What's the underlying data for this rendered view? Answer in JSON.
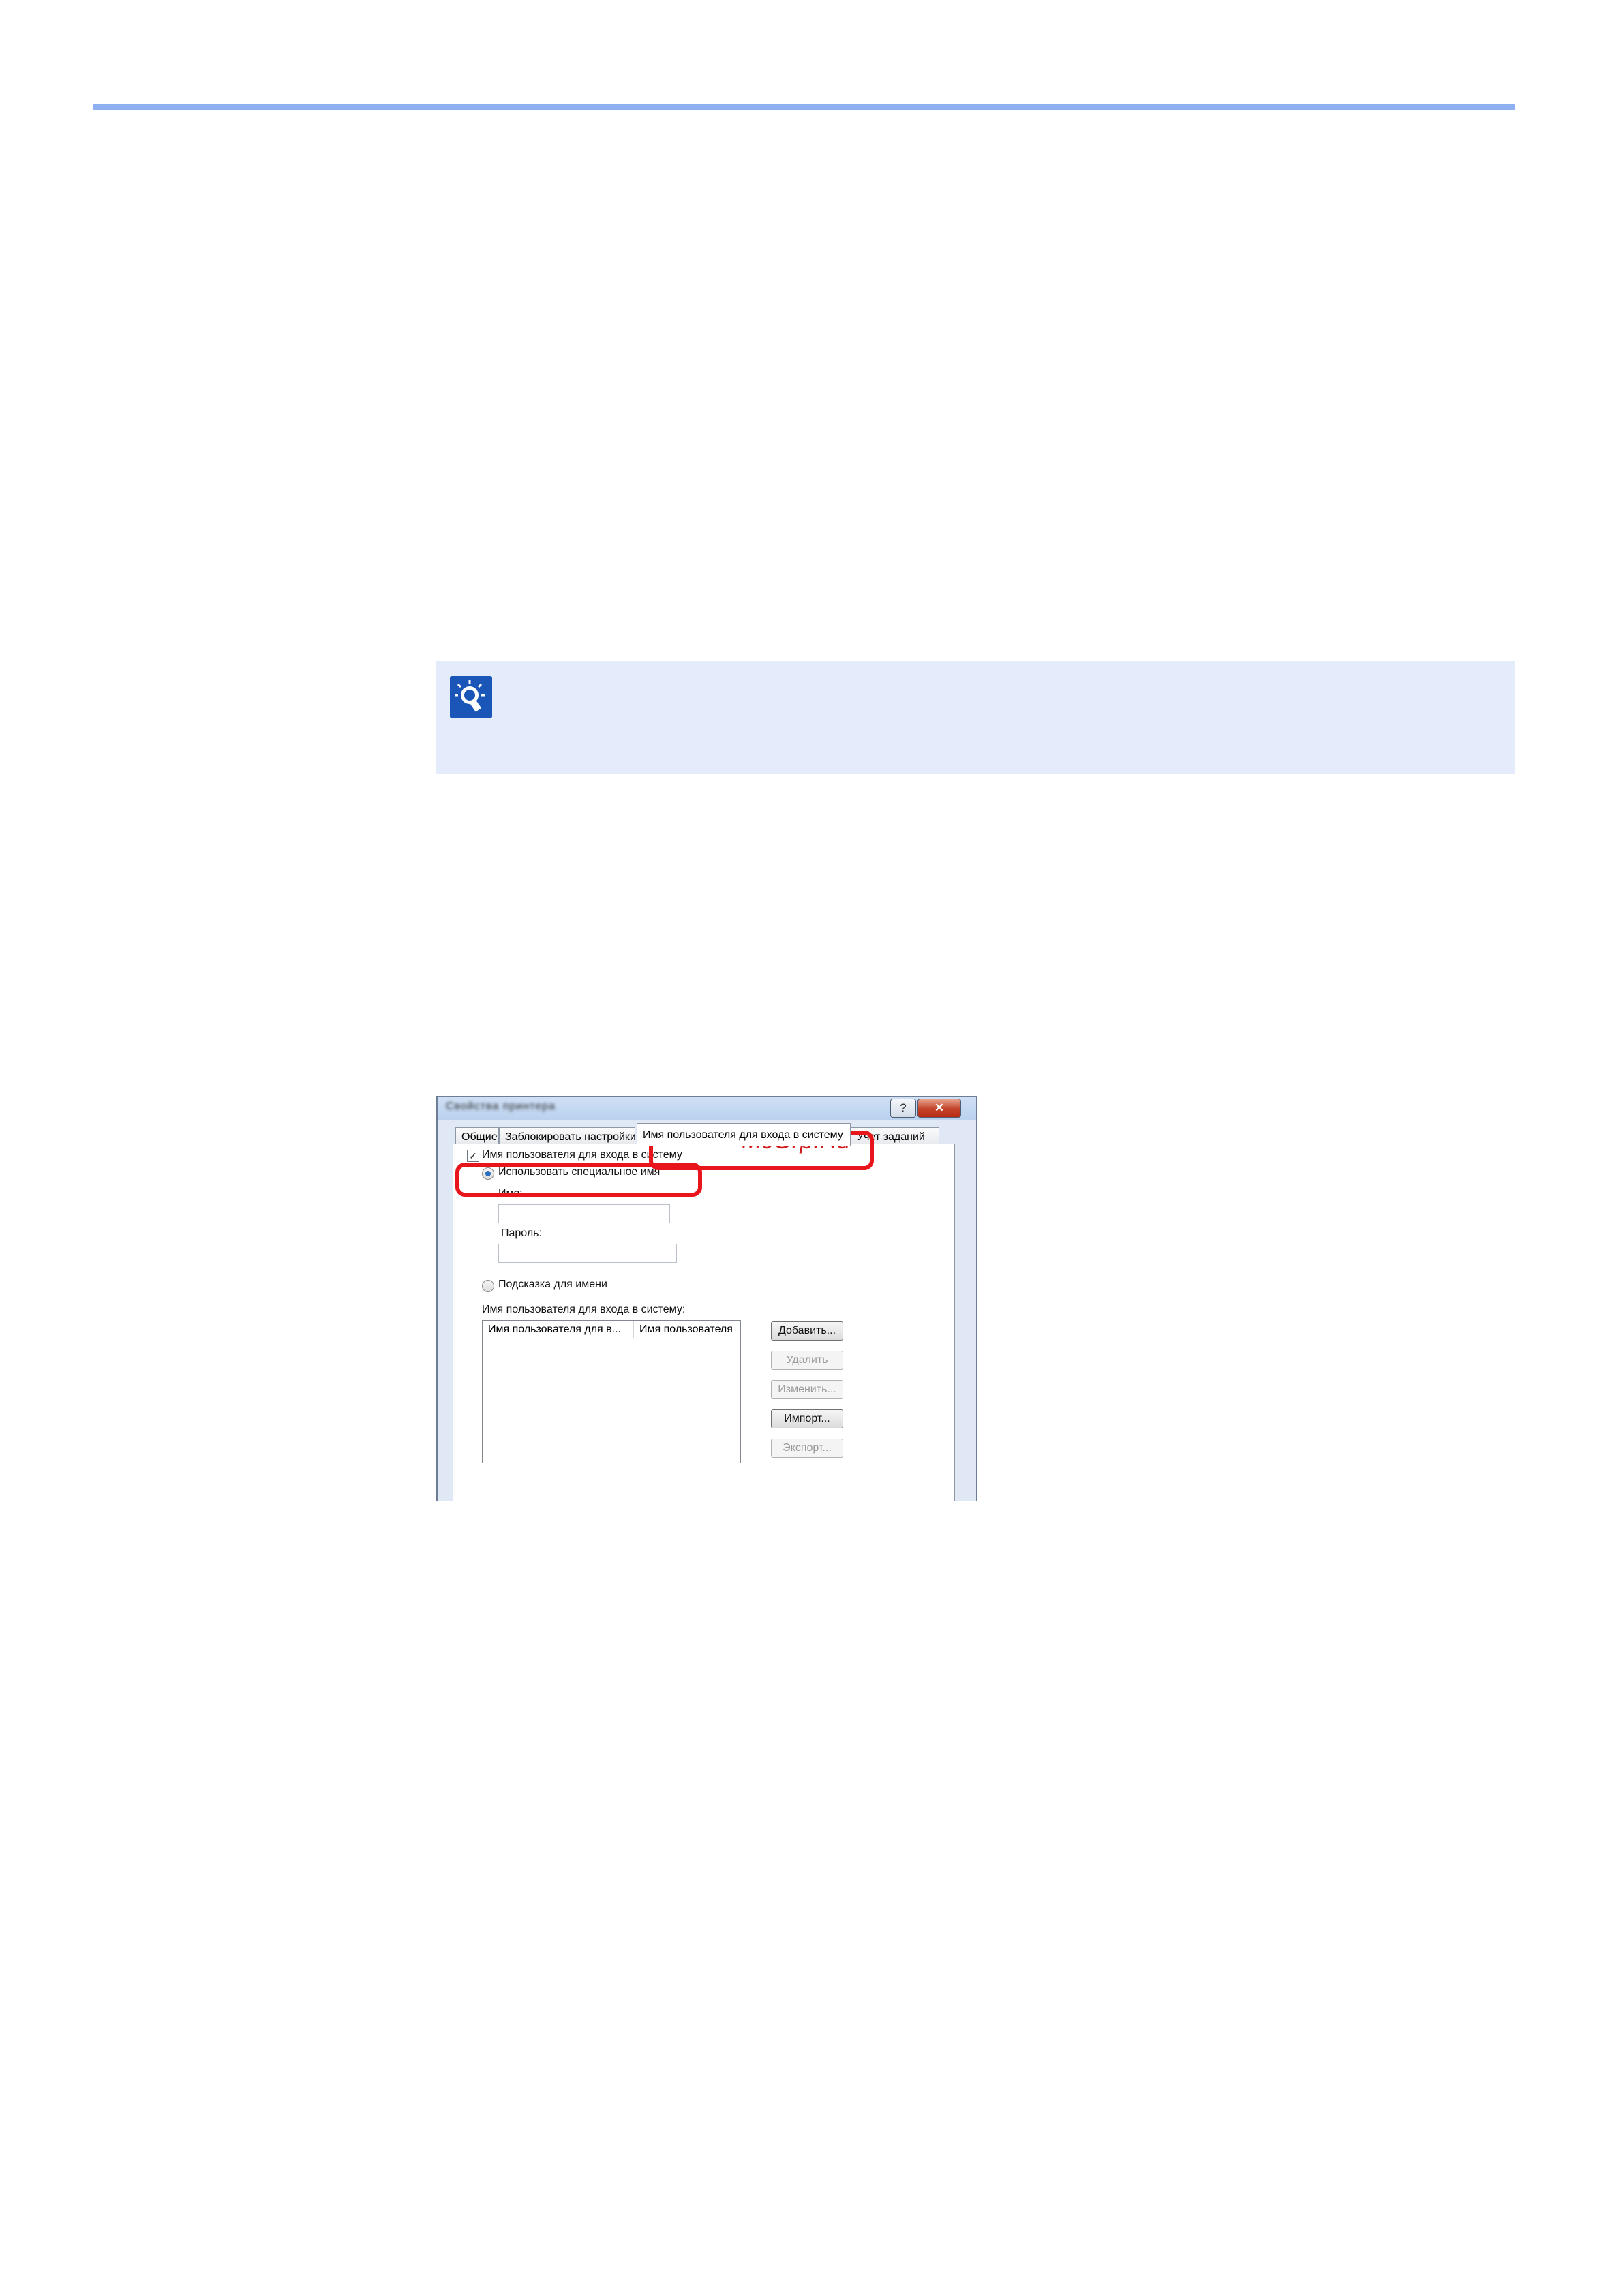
{
  "colors": {
    "accent_rule": "#8fb0f0",
    "note_bg": "#e4ebfb",
    "highlight": "#e8151b",
    "close_button": "#c3432a"
  },
  "note": {
    "icon": "lightbulb-icon"
  },
  "dialog": {
    "title": "Свойства принтера",
    "help_label": "?",
    "close_label": "✕",
    "tabs": [
      "Общие",
      "Заблокировать настройки",
      "Имя пользователя для входа в систему",
      "Учет заданий"
    ],
    "active_tab": 2,
    "login_checkbox": {
      "label": "Имя пользователя для входа в систему",
      "checked": true
    },
    "use_specific_name": {
      "label": "Использовать специальное имя",
      "selected": true
    },
    "name_field": {
      "label": "Имя:",
      "value": ""
    },
    "password_field": {
      "label": "Пароль:",
      "value": ""
    },
    "prompt_for_name": {
      "label": "Подсказка для имени",
      "selected": false
    },
    "list_label": "Имя пользователя для входа в систему:",
    "list_columns": [
      "Имя пользователя для в...",
      "Имя пользователя"
    ],
    "buttons": {
      "add": "Добавить...",
      "delete": "Удалить",
      "edit": "Изменить...",
      "import": "Импорт...",
      "export": "Экспорт..."
    }
  },
  "watermark": "McGrp.Ru"
}
